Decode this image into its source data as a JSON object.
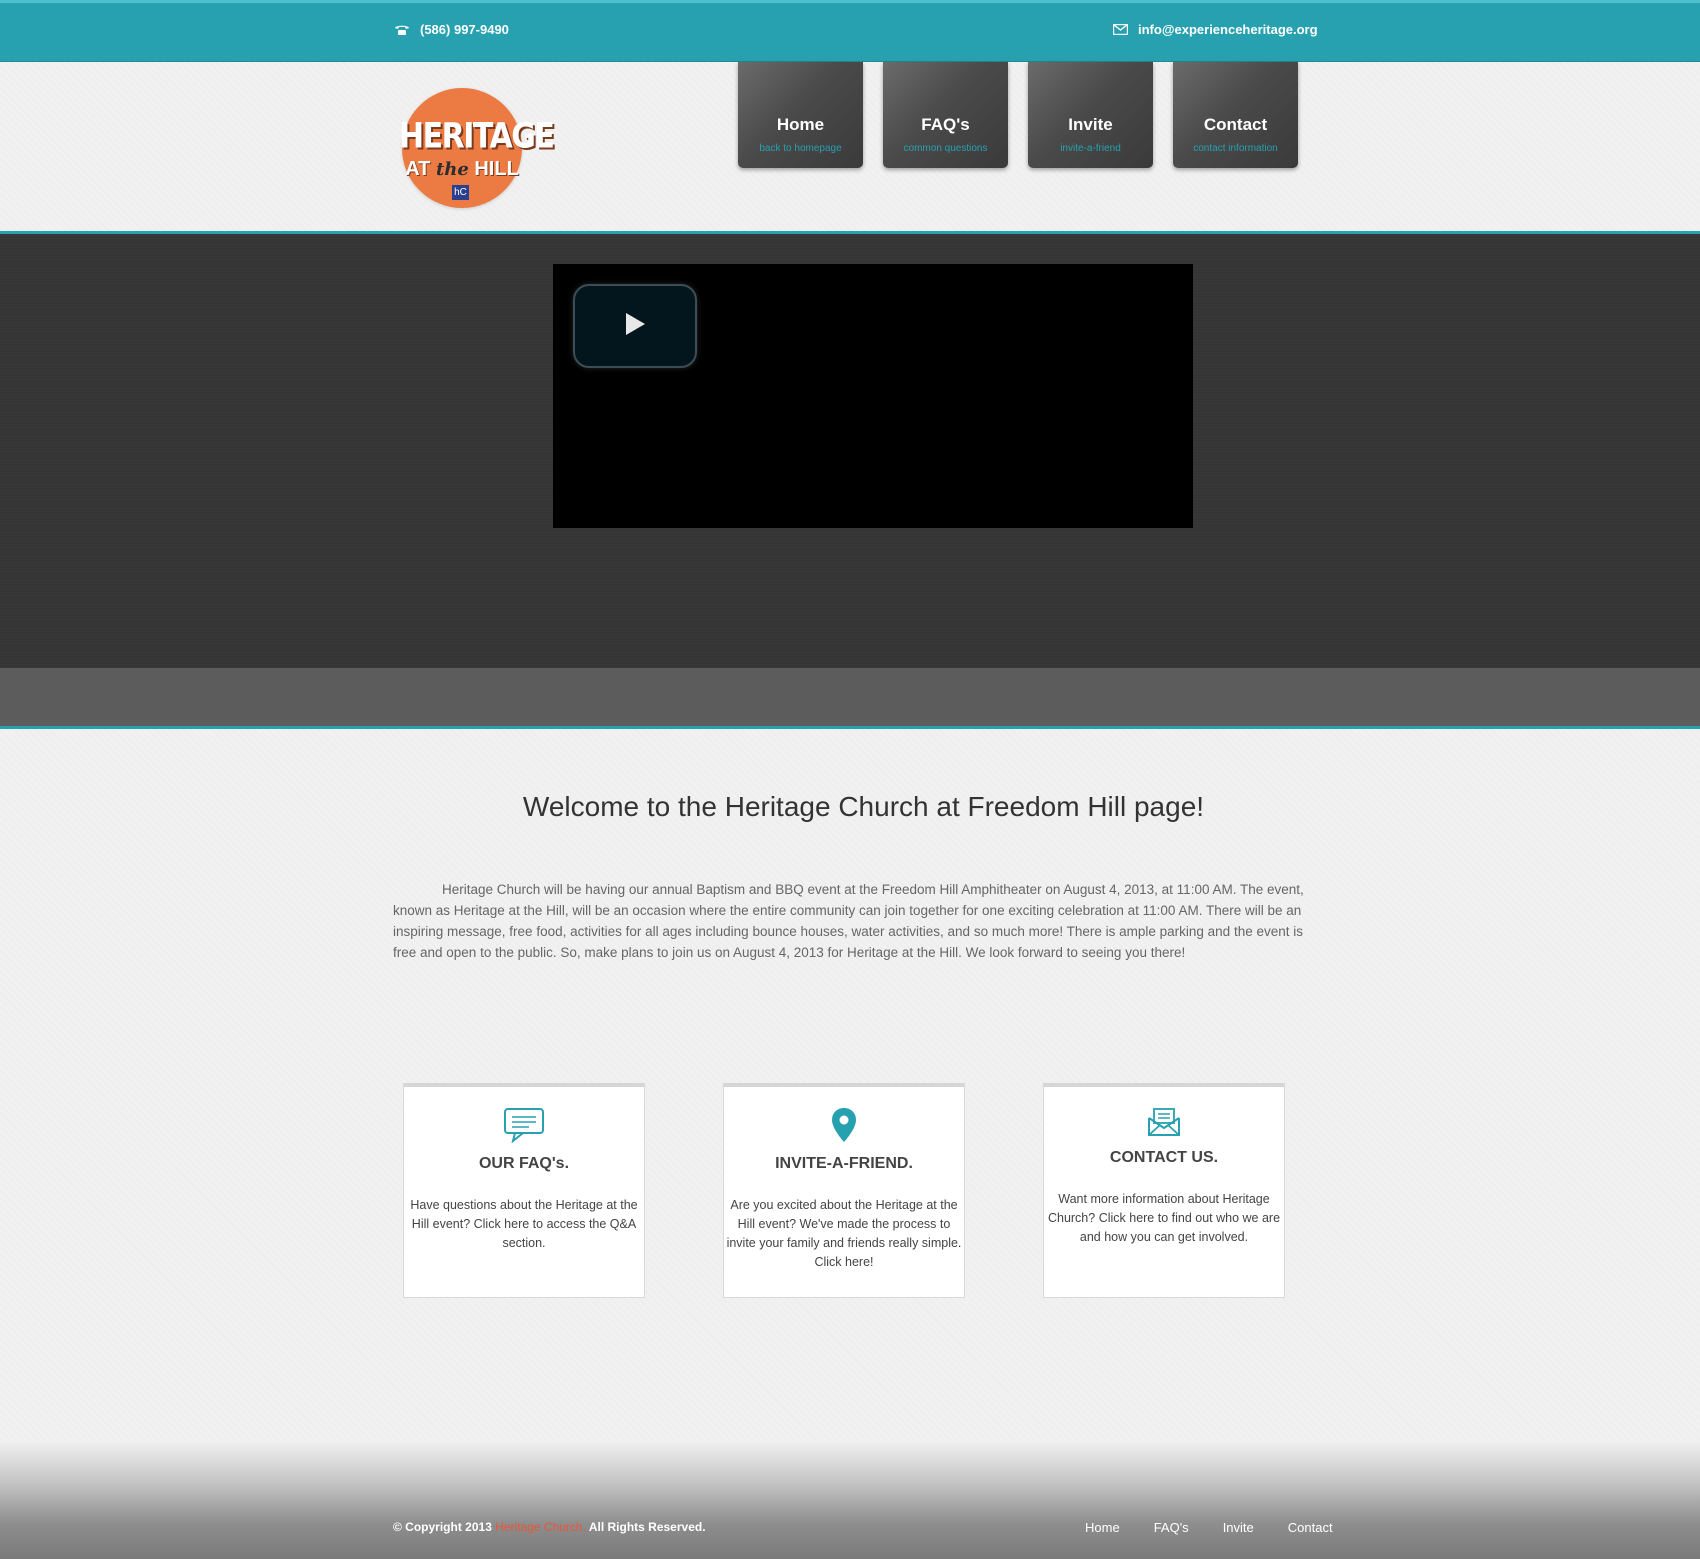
{
  "topbar": {
    "phone": "(586) 997-9490",
    "email": "info@experienceheritage.org",
    "phone_icon": "phone-icon",
    "email_icon": "envelope-icon"
  },
  "logo": {
    "line1": "HERITAGE",
    "line2_a": "AT",
    "line2_b": "the",
    "line2_c": "HILL",
    "badge": "hC"
  },
  "nav": [
    {
      "title": "Home",
      "sub": "back to homepage"
    },
    {
      "title": "FAQ's",
      "sub": "common questions"
    },
    {
      "title": "Invite",
      "sub": "invite-a-friend"
    },
    {
      "title": "Contact",
      "sub": "contact information"
    }
  ],
  "video": {
    "play_icon": "play-icon"
  },
  "main": {
    "welcome": "Welcome to the Heritage Church at Freedom Hill page!",
    "intro": "Heritage Church will be having our annual Baptism and BBQ event at the Freedom Hill Amphitheater on August 4, 2013, at 11:00 AM. The event, known as Heritage at the Hill, will be an occasion where the entire community can join together for one exciting celebration at 11:00 AM. There will be an inspiring message, free food, activities for all ages including bounce houses, water activities, and so much more! There is ample parking and the event is free and open to the public. So, make plans to join us on August 4, 2013 for Heritage at the Hill. We look forward to seeing you there!"
  },
  "cards": [
    {
      "icon": "chat-bubble-icon",
      "title": "OUR FAQ's.",
      "text": "Have questions about the Heritage at the Hill event? Click here to access the Q&A section."
    },
    {
      "icon": "map-pin-icon",
      "title": "INVITE-A-FRIEND.",
      "text": "Are you excited about the Heritage at the Hill event? We've made the process to invite your family and friends really simple. Click here!"
    },
    {
      "icon": "open-envelope-icon",
      "title": "CONTACT US.",
      "text": "Want more information about Heritage Church? Click here to find out who we are and how you can get involved."
    }
  ],
  "footer": {
    "copy_prefix": "© Copyright 2013",
    "brand": "Heritage Church.",
    "copy_suffix": "All Rights Reserved.",
    "links": [
      "Home",
      "FAQ's",
      "Invite",
      "Contact"
    ]
  },
  "colors": {
    "accent": "#27a1b0",
    "logo_orange": "#ec7a43",
    "brand_red": "#e8553a"
  }
}
